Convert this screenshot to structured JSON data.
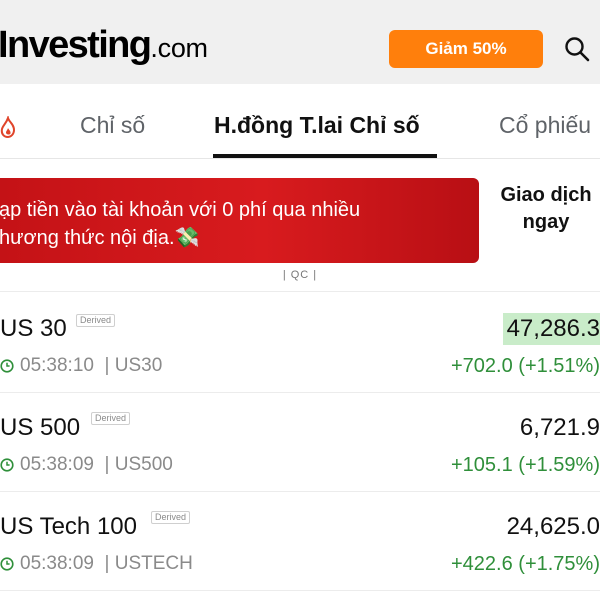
{
  "header": {
    "logo_main": "Investing",
    "logo_suffix": ".com",
    "promo_label": "Giảm 50%",
    "search_icon": "search-icon"
  },
  "tabs": [
    {
      "label": "",
      "icon": "fire-icon"
    },
    {
      "label": "Chỉ số"
    },
    {
      "label": "H.đồng T.lai Chỉ số",
      "active": true
    },
    {
      "label": "Cổ phiếu"
    }
  ],
  "ad": {
    "line1": "ạp tiền vào tài khoản với 0 phí qua nhiều",
    "line2": "hương thức nội địa.💸",
    "cta": "Giao dịch ngay",
    "label": "| QC |"
  },
  "rows": [
    {
      "symbol": "US 30",
      "badge": "Derived",
      "time": "05:38:10",
      "code": "| US30",
      "price": "47,286.3",
      "change": "+702.0 (+1.51%)",
      "highlight": true
    },
    {
      "symbol": "US 500",
      "badge": "Derived",
      "time": "05:38:09",
      "code": "| US500",
      "price": "6,721.9",
      "change": "+105.1 (+1.59%)",
      "highlight": false
    },
    {
      "symbol": "US Tech 100",
      "badge": "Derived",
      "time": "05:38:09",
      "code": "| USTECH",
      "price": "24,625.0",
      "change": "+422.6 (+1.75%)",
      "highlight": false
    }
  ],
  "colors": {
    "promo": "#ff7f0c",
    "ad_red": "#d81b1e",
    "positive": "#2f8f3a",
    "price_highlight": "#c9ecc9"
  }
}
